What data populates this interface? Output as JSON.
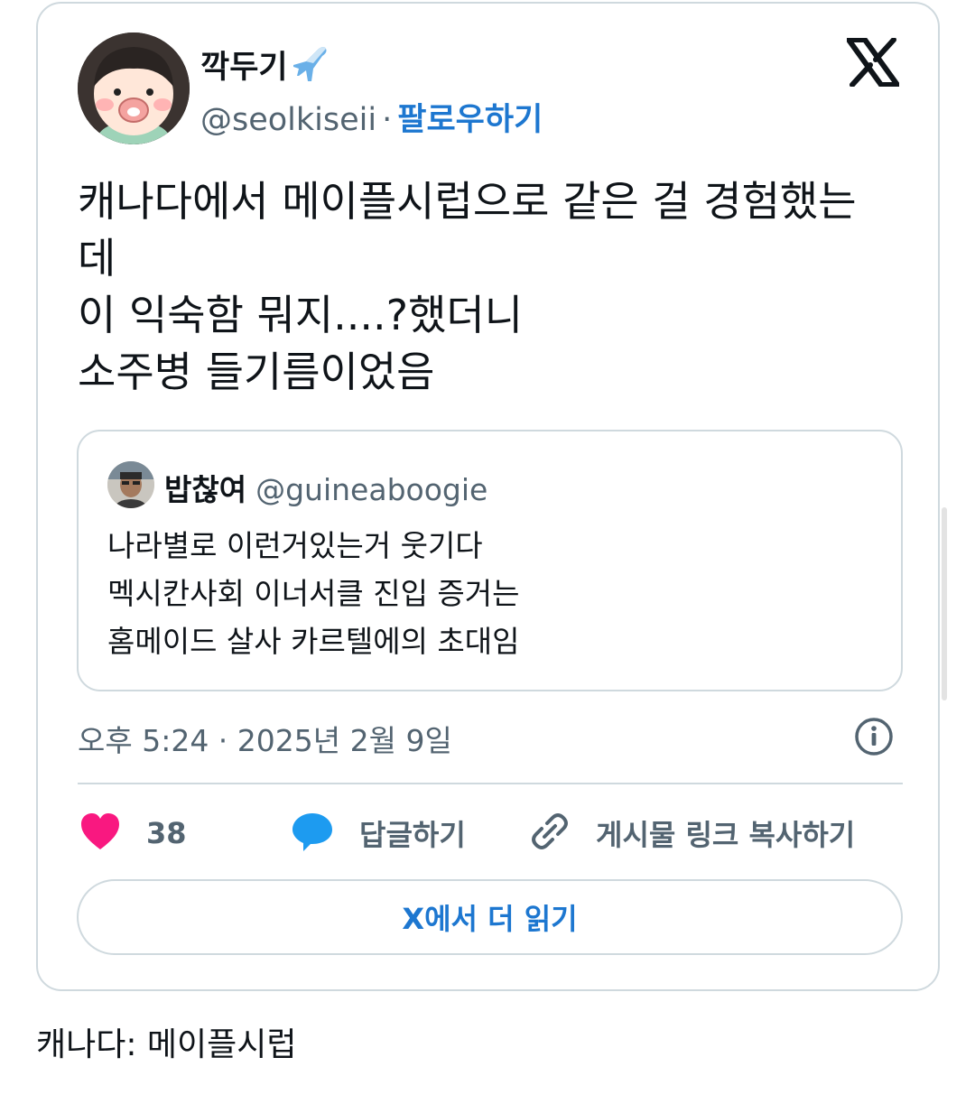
{
  "tweet": {
    "author": {
      "display_name": "깍두기",
      "handle": "@seolkiseii",
      "follow_label": "팔로우하기"
    },
    "separator": "·",
    "text": "캐나다에서 메이플시럽으로 같은 걸 경험했는\n데\n이 익숙함 뭐지....?했더니\n소주병 들기름이었음",
    "quoted": {
      "display_name": "밥찮여",
      "handle": "@guineaboogie",
      "text": "나라별로 이런거있는거 웃기다\n멕시칸사회 이너서클 진입 증거는\n홈메이드 살사 카르텔에의 초대임"
    },
    "timestamp": "오후 5:24 · 2025년 2월 9일",
    "actions": {
      "like_count": "38",
      "reply_label": "답글하기",
      "copy_link_label": "게시물 링크 복사하기"
    },
    "read_more_label": "X에서 더 읽기"
  },
  "caption": "캐나다: 메이플시럽",
  "colors": {
    "accent_blue": "#1d77d0",
    "like_pink": "#f91880",
    "reply_blue": "#1d9bf0",
    "secondary_text": "#536471",
    "border": "#cfd9de"
  },
  "icons": [
    "airplane-emoji",
    "x-logo-icon",
    "info-icon",
    "heart-icon",
    "reply-bubble-icon",
    "link-icon"
  ]
}
